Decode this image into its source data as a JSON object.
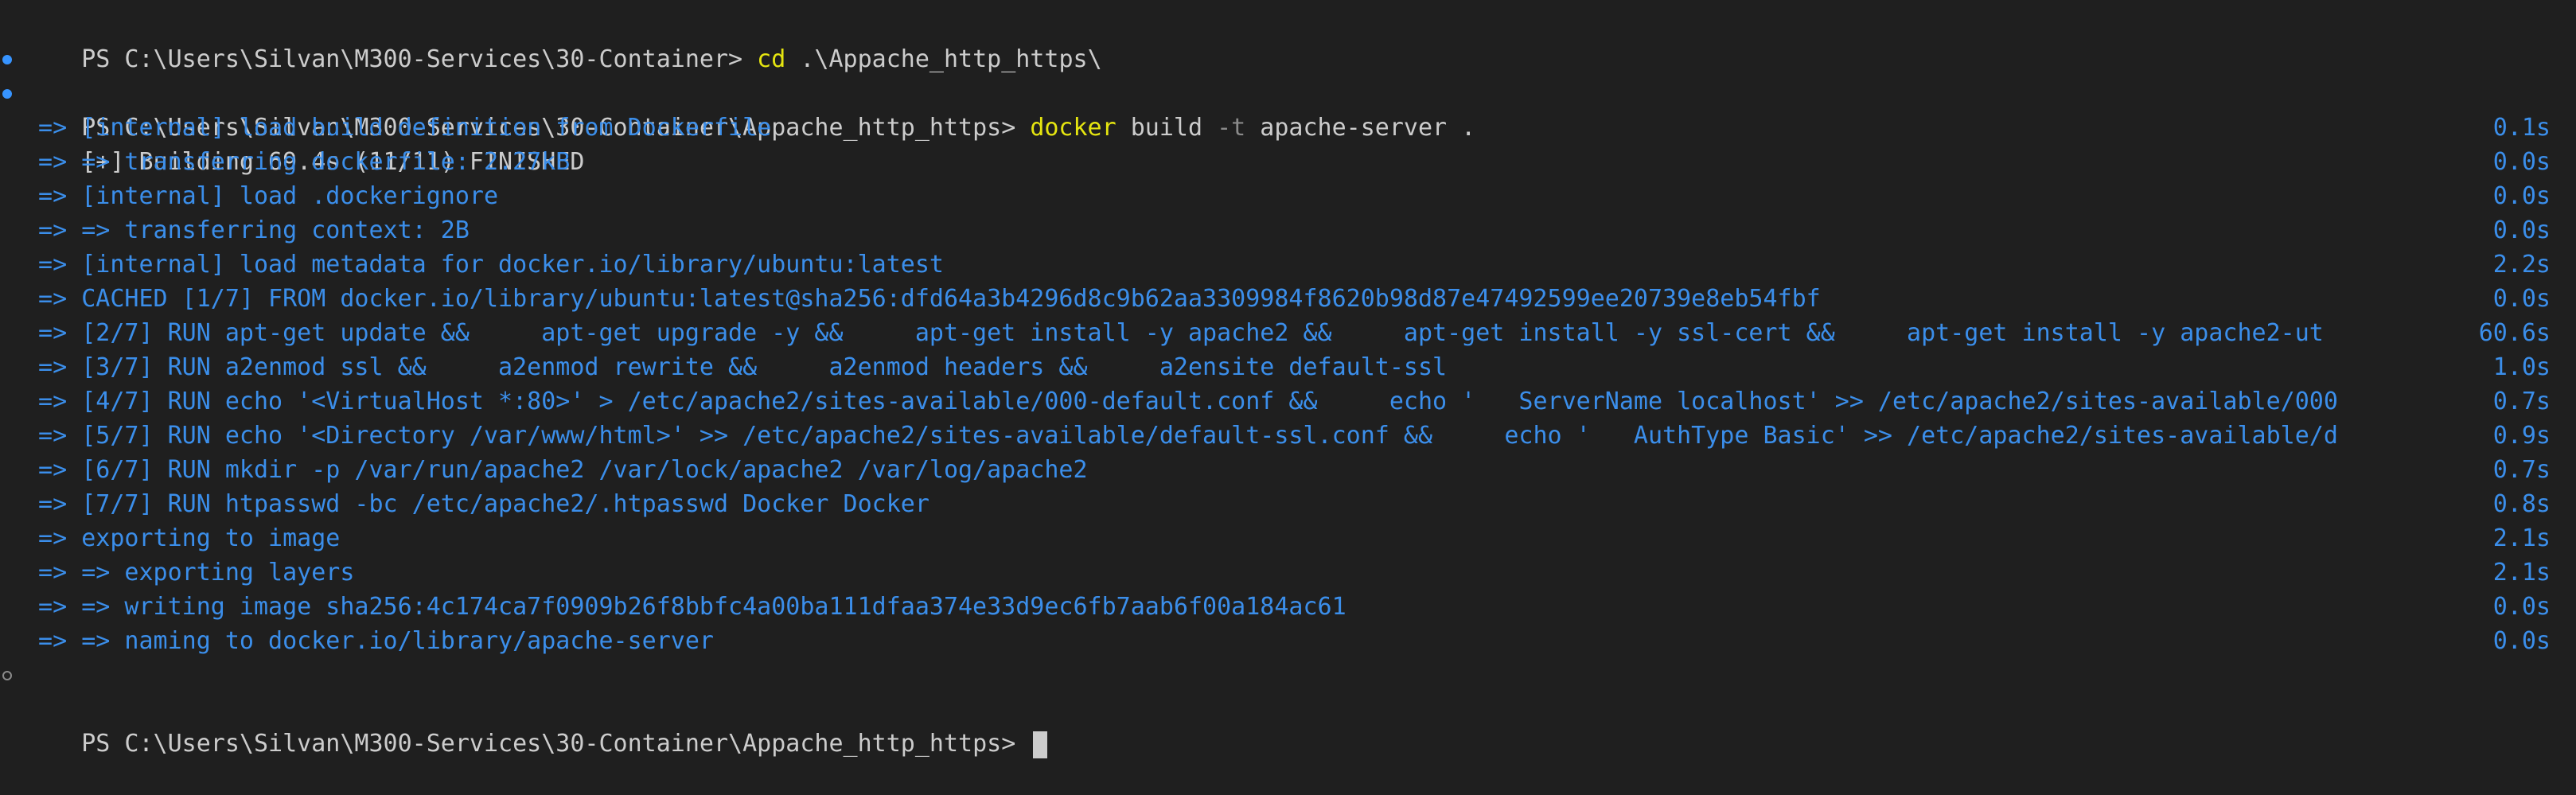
{
  "terminal": {
    "lines": {
      "cd_prompt": "PS C:\\Users\\Silvan\\M300-Services\\30-Container> ",
      "cd_cmd": "cd",
      "cd_arg": " .\\Appache_http_https\\",
      "build_prompt": "PS C:\\Users\\Silvan\\M300-Services\\30-Container\\Appache_http_https> ",
      "build_cmd": "docker",
      "build_args_1": " build ",
      "build_flag": "-t",
      "build_args_2": " apache-server .",
      "building_status": "[+] Building 69.4s (11/11) FINISHED",
      "final_prompt": "PS C:\\Users\\Silvan\\M300-Services\\30-Container\\Appache_http_https> "
    },
    "steps": [
      {
        "text": " => [internal] load build definition from Dockerfile",
        "time": "0.1s"
      },
      {
        "text": " => => transferring dockerfile: 2.27kB",
        "time": "0.0s"
      },
      {
        "text": " => [internal] load .dockerignore",
        "time": "0.0s"
      },
      {
        "text": " => => transferring context: 2B",
        "time": "0.0s"
      },
      {
        "text": " => [internal] load metadata for docker.io/library/ubuntu:latest",
        "time": "2.2s"
      },
      {
        "text": " => CACHED [1/7] FROM docker.io/library/ubuntu:latest@sha256:dfd64a3b4296d8c9b62aa3309984f8620b98d87e47492599ee20739e8eb54fbf",
        "time": "0.0s"
      },
      {
        "text": " => [2/7] RUN apt-get update &&     apt-get upgrade -y &&     apt-get install -y apache2 &&     apt-get install -y ssl-cert &&     apt-get install -y apache2-ut",
        "time": "60.6s"
      },
      {
        "text": " => [3/7] RUN a2enmod ssl &&     a2enmod rewrite &&     a2enmod headers &&     a2ensite default-ssl",
        "time": "1.0s"
      },
      {
        "text": " => [4/7] RUN echo '<VirtualHost *:80>' > /etc/apache2/sites-available/000-default.conf &&     echo '   ServerName localhost' >> /etc/apache2/sites-available/000",
        "time": "0.7s"
      },
      {
        "text": " => [5/7] RUN echo '<Directory /var/www/html>' >> /etc/apache2/sites-available/default-ssl.conf &&     echo '   AuthType Basic' >> /etc/apache2/sites-available/d",
        "time": "0.9s"
      },
      {
        "text": " => [6/7] RUN mkdir -p /var/run/apache2 /var/lock/apache2 /var/log/apache2",
        "time": "0.7s"
      },
      {
        "text": " => [7/7] RUN htpasswd -bc /etc/apache2/.htpasswd Docker Docker",
        "time": "0.8s"
      },
      {
        "text": " => exporting to image",
        "time": "2.1s"
      },
      {
        "text": " => => exporting layers",
        "time": "2.1s"
      },
      {
        "text": " => => writing image sha256:4c174ca7f0909b26f8bbfc4a00ba111dfaa374e33d9ec6fb7aab6f00a184ac61",
        "time": "0.0s"
      },
      {
        "text": " => => naming to docker.io/library/apache-server",
        "time": "0.0s"
      }
    ],
    "colors": {
      "background": "#1f1f1f",
      "text": "#cccccc",
      "command": "#e5e510",
      "step_blue": "#3b8eea",
      "marker_blue": "#3794ff"
    },
    "icons": {
      "success_marker": "filled-dot",
      "pending_marker": "hollow-circle"
    }
  }
}
